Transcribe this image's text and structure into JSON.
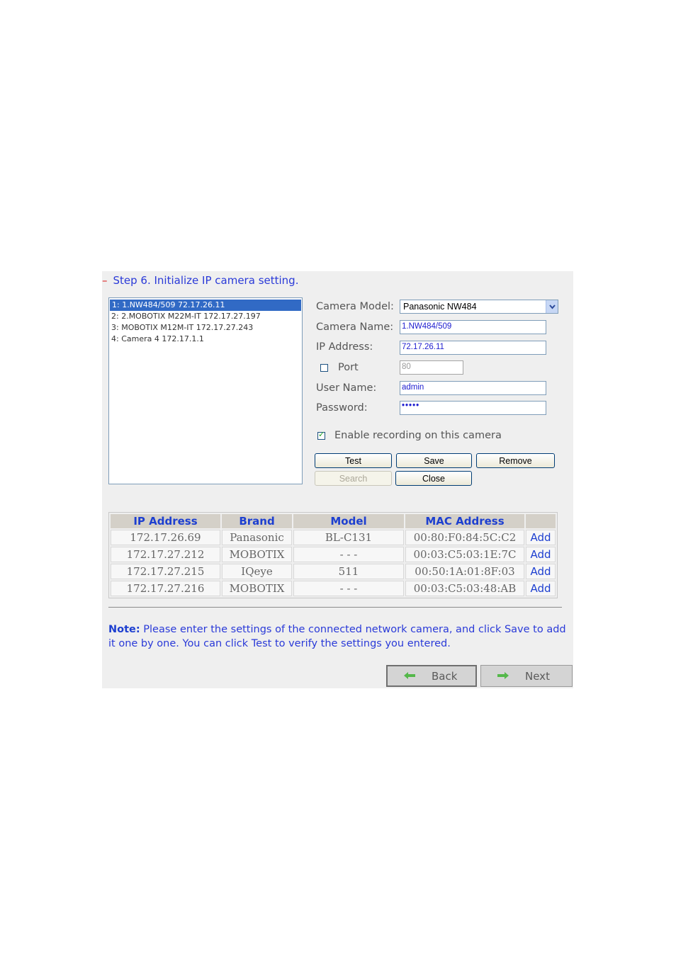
{
  "step": {
    "dash": "–",
    "title": "Step 6. Initialize IP camera setting."
  },
  "camera_list": [
    "1: 1.NW484/509  72.17.26.11",
    "2: 2.MOBOTIX M22M-IT  172.17.27.197",
    "3: MOBOTIX M12M-IT  172.17.27.243",
    "4: Camera 4  172.17.1.1"
  ],
  "form": {
    "model_label": "Camera Model:",
    "model_value": "Panasonic NW484",
    "name_label": "Camera Name:",
    "name_value": "1.NW484/509",
    "ip_label": "IP Address:",
    "ip_value": "72.17.26.11",
    "port_label": "Port",
    "port_value": "80",
    "user_label": "User Name:",
    "user_value": "admin",
    "password_label": "Password:",
    "password_value": "•••••",
    "enable_label": "Enable recording on this camera",
    "enable_checked": true,
    "port_checked": false
  },
  "buttons": {
    "test": "Test",
    "save": "Save",
    "remove": "Remove",
    "search": "Search",
    "close": "Close"
  },
  "scan_table": {
    "headers": [
      "IP Address",
      "Brand",
      "Model",
      "MAC Address"
    ],
    "rows": [
      {
        "ip": "172.17.26.69",
        "brand": "Panasonic",
        "model": "BL-C131",
        "mac": "00:80:F0:84:5C:C2",
        "action": "Add"
      },
      {
        "ip": "172.17.27.212",
        "brand": "MOBOTIX",
        "model": "- - -",
        "mac": "00:03:C5:03:1E:7C",
        "action": "Add"
      },
      {
        "ip": "172.17.27.215",
        "brand": "IQeye",
        "model": "511",
        "mac": "00:50:1A:01:8F:03",
        "action": "Add"
      },
      {
        "ip": "172.17.27.216",
        "brand": "MOBOTIX",
        "model": "- - -",
        "mac": "00:03:C5:03:48:AB",
        "action": "Add"
      }
    ]
  },
  "note": {
    "label": "Note:",
    "text": " Please enter the settings of the connected network camera, and click Save to add it one by one. You can click Test to verify the settings you entered."
  },
  "nav": {
    "back": "Back",
    "next": "Next"
  },
  "colors": {
    "accent_blue": "#2a3ad8",
    "selected": "#316ac5",
    "arrow_green": "#54b84a"
  }
}
